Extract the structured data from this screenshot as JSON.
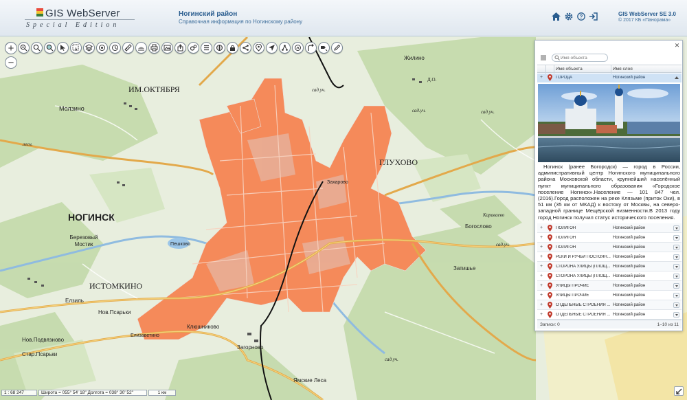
{
  "app": {
    "logo_title": "GIS WebServer",
    "logo_subtitle": "Special Edition",
    "header_title": "Ногинский район",
    "header_subtitle": "Справочная информация по Ногинскому району",
    "product_name": "GIS WebServer SE 3.0",
    "product_copyright": "© 2017 КБ «Панорама»"
  },
  "header_icons": [
    "home-icon",
    "settings-icon",
    "help-icon",
    "logout-icon"
  ],
  "toolbar_icons": [
    "zoom-in-icon",
    "zoom-out-icon",
    "zoom-extent-icon",
    "zoom-area-icon",
    "select-icon",
    "select-area-icon",
    "layers-icon",
    "legend-icon",
    "route-icon",
    "measure-icon",
    "fill-icon",
    "print-icon",
    "image-icon",
    "export-icon",
    "settings-gear-icon",
    "list-icon",
    "map-settings-icon",
    "lock-icon",
    "graph-icon",
    "location-icon",
    "navigate-icon",
    "share-icon",
    "info-icon",
    "route-turn-icon",
    "bookmark-icon",
    "edit-icon"
  ],
  "zoom": {
    "plus": "+",
    "minus": "−"
  },
  "map_labels": [
    {
      "text": "ИМ.ОКТЯБРЯ"
    },
    {
      "text": "Молзино"
    },
    {
      "text": "НОГИНСК"
    },
    {
      "text": "Березовый Мостик"
    },
    {
      "text": "ИСТОМКИНО"
    },
    {
      "text": "ГЛУХОВО"
    },
    {
      "text": "Жилино"
    },
    {
      "text": "Богослово"
    },
    {
      "text": "Затишье"
    },
    {
      "text": "Караваево"
    },
    {
      "text": "Ямские Леса"
    },
    {
      "text": "Загорново"
    },
    {
      "text": "Клюшниково"
    },
    {
      "text": "Нов.Псарьки"
    },
    {
      "text": "Стар.Псарьки"
    },
    {
      "text": "Нов.Подвязново"
    },
    {
      "text": "Елизаветино"
    },
    {
      "text": "Елзиль"
    },
    {
      "text": "Пешково"
    },
    {
      "text": "сад.уч."
    },
    {
      "text": "сад.уч."
    },
    {
      "text": "сад.уч."
    },
    {
      "text": "сад.уч."
    },
    {
      "text": "сад.уч."
    },
    {
      "text": "Д.О."
    },
    {
      "text": "лесн."
    },
    {
      "text": "Захарово"
    }
  ],
  "panel": {
    "search_placeholder": "Имя объекта",
    "col_name": "Имя объекта",
    "col_layer": "Имя слоя",
    "selected": {
      "name": "ГОРОДА",
      "layer": "Ногинский район"
    },
    "description": "Ногинск (ранее Богородск) — город в России, административный центр Ногинского муниципального района Московской области, крупнейший населённый пункт муниципального образования «Городское поселение Ногинск».Население — 101 847 чел. (2016).Город расположен на реке Клязьме (приток Оки), в 51 км (35 км от МКАД) к востоку от Москвы, на северо-западной границе Мещёрской низменности.В 2013 году город Ногинск получил статус исторического поселения.",
    "rows": [
      {
        "name": "ПОЛИГОН",
        "layer": "Ногинский район"
      },
      {
        "name": "ПОЛИГОН",
        "layer": "Ногинский район"
      },
      {
        "name": "ПОЛИГОН",
        "layer": "Ногинский район"
      },
      {
        "name": "РЕКИ И РУЧЬИ ПОСТОЯН...",
        "layer": "Ногинский район"
      },
      {
        "name": "СТОРОНА УЛИЦЫ (ПЛОЩ...",
        "layer": "Ногинский район"
      },
      {
        "name": "СТОРОНА УЛИЦЫ (ПЛОЩ...",
        "layer": "Ногинский район"
      },
      {
        "name": "УЛИЦЫ ПРОЧИЕ",
        "layer": "Ногинский район"
      },
      {
        "name": "УЛИЦЫ ПРОЧИЕ",
        "layer": "Ногинский район"
      },
      {
        "name": "ОТДЕЛЬНЫЕ СТРОЕНИЯ ...",
        "layer": "Ногинский район"
      },
      {
        "name": "ОТДЕЛЬНЫЕ СТРОЕНИЯ ...",
        "layer": "Ногинский район"
      }
    ],
    "footer_left": "Записи: 0",
    "footer_right": "1–10 из 11"
  },
  "status": {
    "scale": "1 : 68 247",
    "coords": "Широта = 055° 54' 18\"  Долгота = 038° 30' 52\"",
    "scalebar": "1 км"
  },
  "colors": {
    "accent": "#2a5d8f",
    "urban": "#f58a5a",
    "forest": "#bfd6a7",
    "water": "#8fbbe0",
    "road": "#e3a94b"
  }
}
